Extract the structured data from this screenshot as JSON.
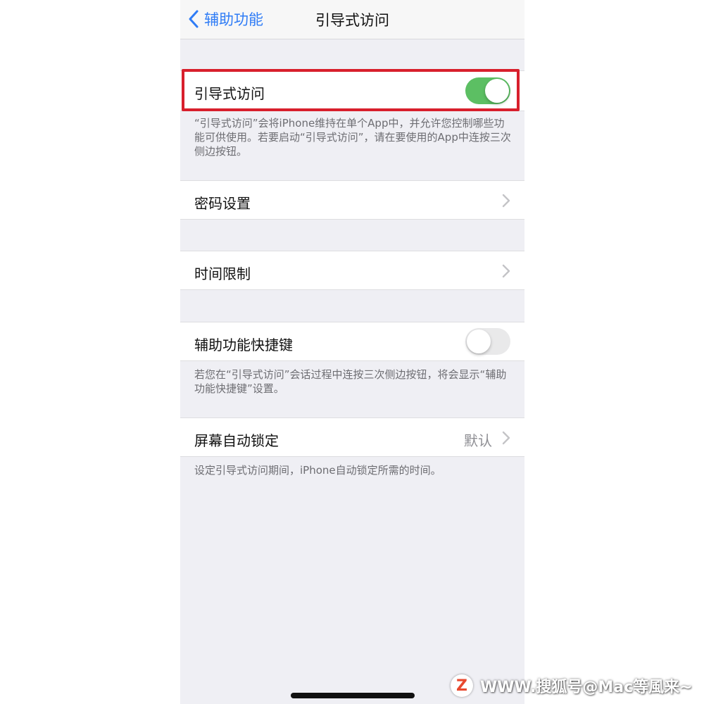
{
  "navbar": {
    "back_label": "辅助功能",
    "title": "引导式访问"
  },
  "guided_access": {
    "label": "引导式访问",
    "toggle_on": true,
    "footer": "“引导式访问”会将iPhone维持在单个App中，并允许您控制哪些功能可供使用。若要启动“引导式访问”，请在要使用的App中连按三次侧边按钮。"
  },
  "passcode_settings": {
    "label": "密码设置"
  },
  "time_limits": {
    "label": "时间限制"
  },
  "accessibility_shortcut": {
    "label": "辅助功能快捷键",
    "toggle_on": false,
    "footer": "若您在“引导式访问”会话过程中连按三次侧边按钮，将会显示“辅助功能快捷键”设置。"
  },
  "auto_lock": {
    "label": "屏幕自动锁定",
    "value": "默认",
    "footer": "设定引导式访问期间，iPhone自动锁定所需的时间。"
  },
  "watermark": {
    "badge": "Z",
    "text": "WWW.搜狐号@Mac等風来~"
  },
  "colors": {
    "accent": "#2f7cf6",
    "toggle_on": "#5cbf63",
    "highlight": "#d81f2c"
  }
}
